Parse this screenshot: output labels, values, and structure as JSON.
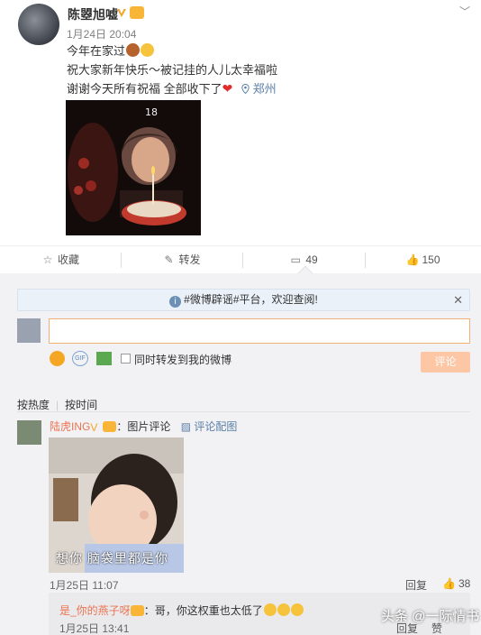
{
  "post": {
    "username": "陈曌旭嘘",
    "time": "1月24日 20:04",
    "text_line1": "今年在家过",
    "text_line2": "祝大家新年快乐～被记挂的人儿太幸福啦",
    "text_line3": "谢谢今天所有祝福 全部收下了",
    "location": "郑州",
    "more_glyph": "﹀",
    "icons": [
      "verified-icon",
      "level-badge-icon",
      "cake-emoji-icon",
      "smile-emoji-icon",
      "heart-icon",
      "location-pin-icon"
    ]
  },
  "actions": {
    "favorite_label": "收藏",
    "repost_label": "转发",
    "comment_count": "49",
    "like_count": "150"
  },
  "comment_box": {
    "notice": "#微博辟谣#平台，欢迎查阅!",
    "input_placeholder": "",
    "gif_label": "GIF",
    "forward_label": "同时转发到我的微博",
    "submit_label": "评论"
  },
  "sort": {
    "hot": "按热度",
    "time": "按时间"
  },
  "comment": {
    "username": "陆虎ING",
    "type_label": "：图片评论",
    "image_link": "评论配图",
    "image_caption": "想你 脑袋里都是你",
    "time": "1月25日 11:07",
    "reply_label": "回复",
    "like_count": "38"
  },
  "reply": {
    "username": "是_你的燕子呀",
    "text": "：哥，你这权重也太低了",
    "time": "1月25日 13:41",
    "reply_label": "回复",
    "like_label": "赞"
  },
  "watermark": "头条 @一际情书",
  "colors": {
    "link": "#eb7350",
    "accent_blue": "#5b80a8",
    "submit_bg": "#fdc6a4",
    "panel_bg": "#f2f2f5"
  }
}
